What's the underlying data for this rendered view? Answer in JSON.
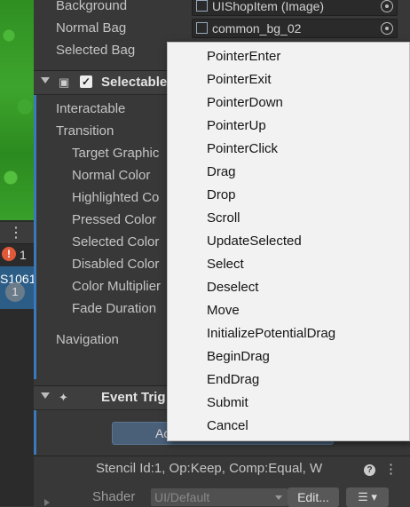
{
  "left_panel": {
    "more_icon": "⋮",
    "warning_count": "1",
    "selected_item_text": "S1061",
    "selected_item_count": "1"
  },
  "properties_top": {
    "background_label": "Background",
    "background_value": "UIShopItem (Image)",
    "normal_bag_label": "Normal Bag",
    "normal_bag_value": "common_bg_02",
    "selected_bag_label": "Selected Bag"
  },
  "selectable_component": {
    "title": "Selectable",
    "interactable_label": "Interactable",
    "transition_label": "Transition",
    "target_graphic_label": "Target Graphic",
    "normal_color_label": "Normal Color",
    "highlighted_color_label": "Highlighted Co",
    "pressed_color_label": "Pressed Color",
    "selected_color_label": "Selected Color",
    "disabled_color_label": "Disabled Color",
    "color_multiplier_label": "Color Multiplier",
    "fade_duration_label": "Fade Duration",
    "navigation_label": "Navigation"
  },
  "event_trigger_component": {
    "title": "Event Trig",
    "add_button_label": "Ac"
  },
  "material": {
    "stencil_text": "Stencil Id:1, Op:Keep, Comp:Equal, W",
    "shader_label": "Shader",
    "shader_value": "UI/Default",
    "edit_button": "Edit...",
    "menu_button": "☰ ▾"
  },
  "event_type_menu": {
    "items": [
      "PointerEnter",
      "PointerExit",
      "PointerDown",
      "PointerUp",
      "PointerClick",
      "Drag",
      "Drop",
      "Scroll",
      "UpdateSelected",
      "Select",
      "Deselect",
      "Move",
      "InitializePotentialDrag",
      "BeginDrag",
      "EndDrag",
      "Submit",
      "Cancel"
    ]
  }
}
